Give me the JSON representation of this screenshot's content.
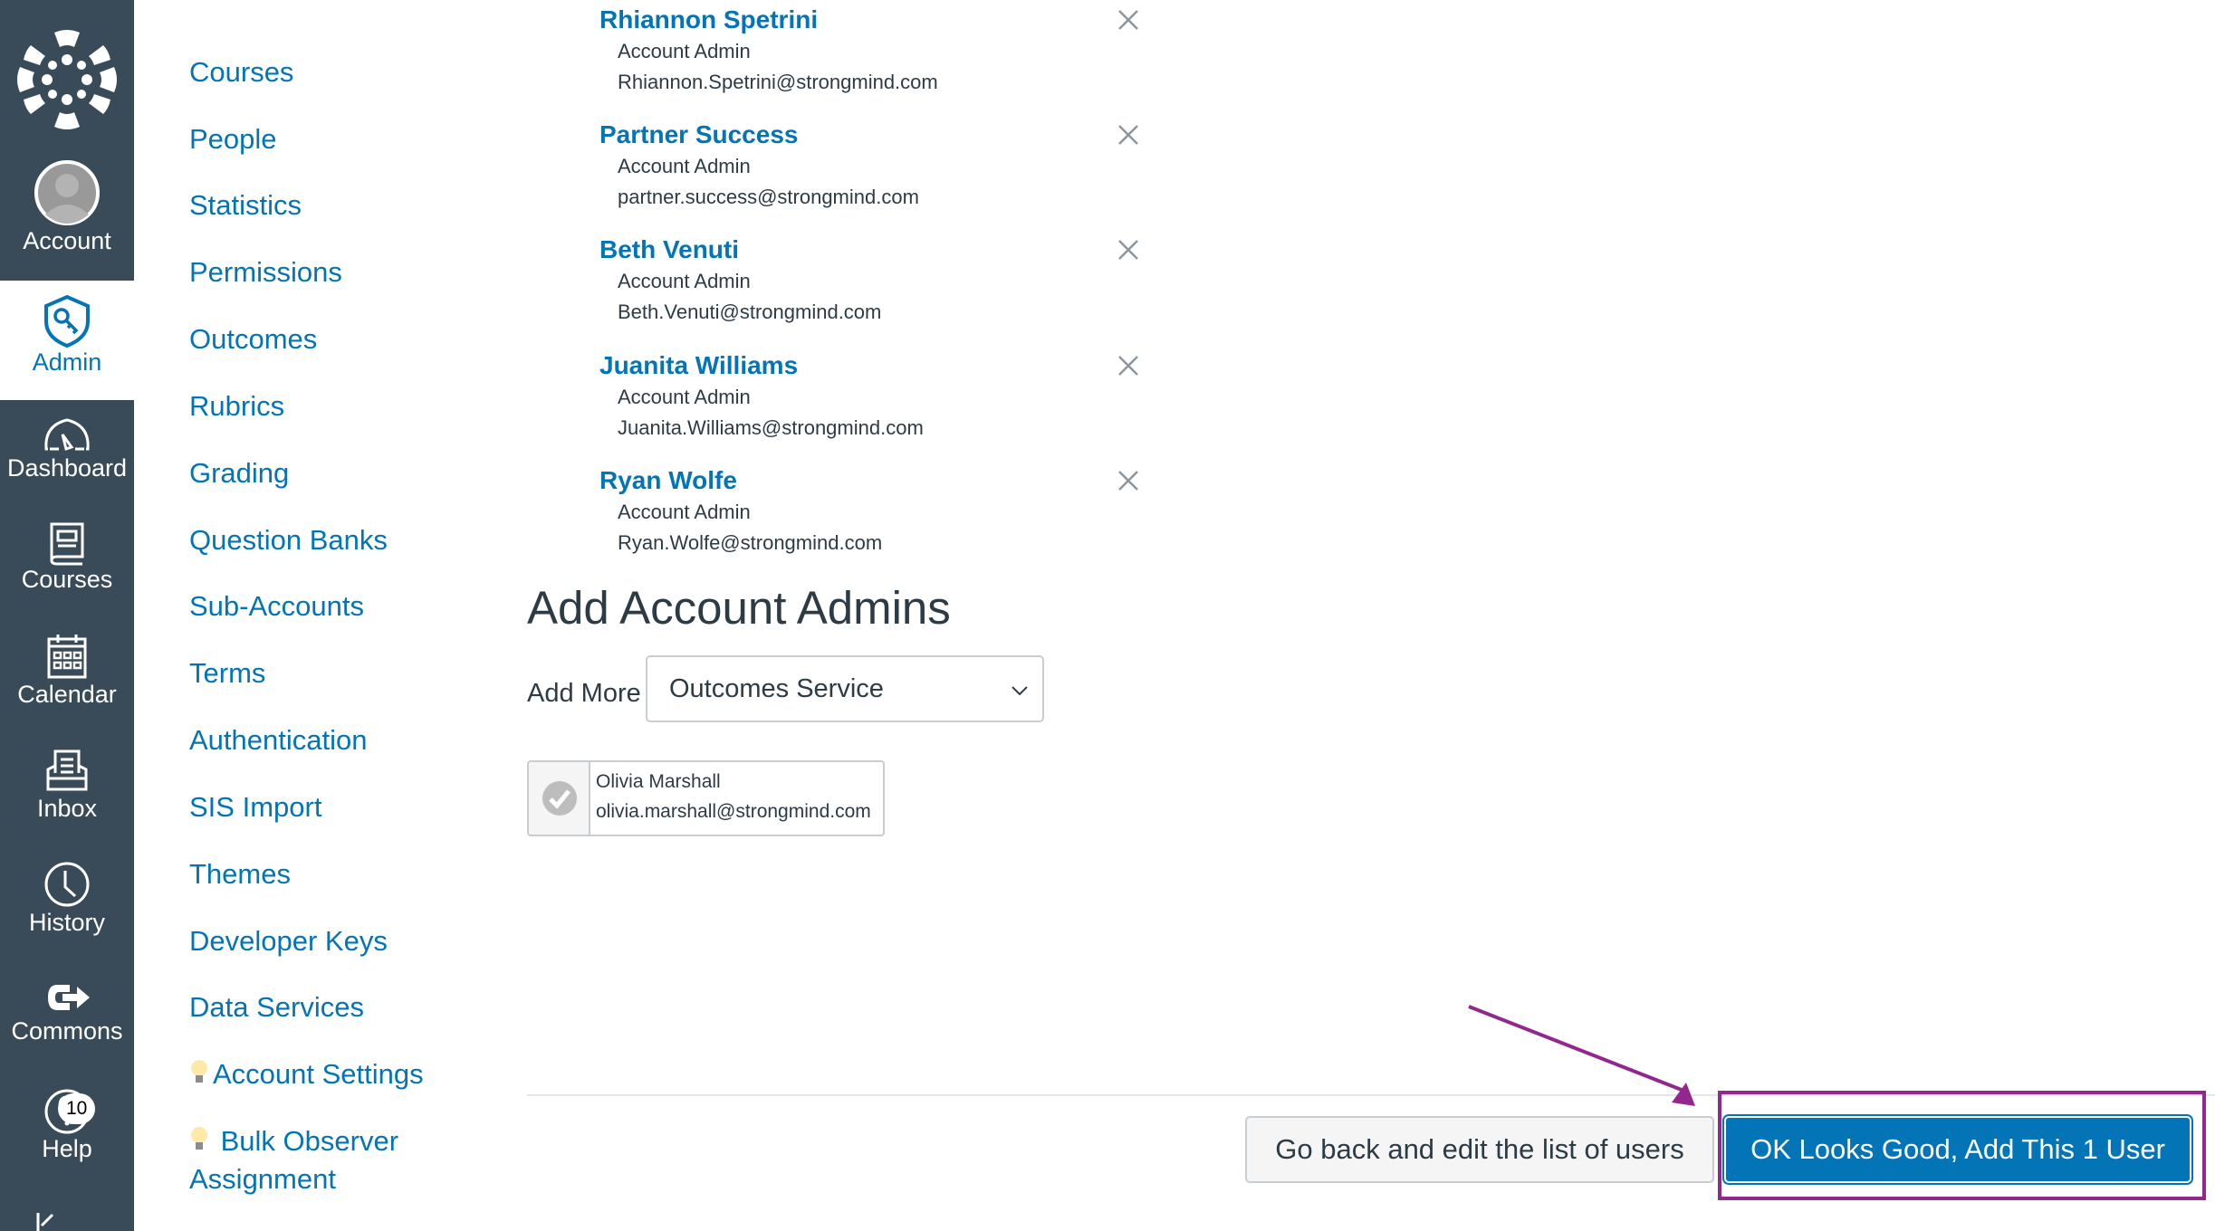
{
  "global_nav": {
    "items": [
      {
        "label": "Account",
        "icon": "avatar-icon"
      },
      {
        "label": "Admin",
        "icon": "admin-shield-key-icon",
        "active": true
      },
      {
        "label": "Dashboard",
        "icon": "dashboard-gauge-icon"
      },
      {
        "label": "Courses",
        "icon": "courses-book-icon"
      },
      {
        "label": "Calendar",
        "icon": "calendar-icon"
      },
      {
        "label": "Inbox",
        "icon": "inbox-icon"
      },
      {
        "label": "History",
        "icon": "clock-icon"
      },
      {
        "label": "Commons",
        "icon": "commons-icon"
      },
      {
        "label": "Help",
        "icon": "help-icon",
        "badge": "10"
      }
    ],
    "accent_color": "#0374b5",
    "bg_color": "#394b58"
  },
  "sub_nav": {
    "items": [
      {
        "label": "Courses"
      },
      {
        "label": "People"
      },
      {
        "label": "Statistics"
      },
      {
        "label": "Permissions"
      },
      {
        "label": "Outcomes"
      },
      {
        "label": "Rubrics"
      },
      {
        "label": "Grading"
      },
      {
        "label": "Question Banks"
      },
      {
        "label": "Sub-Accounts"
      },
      {
        "label": "Terms"
      },
      {
        "label": "Authentication"
      },
      {
        "label": "SIS Import"
      },
      {
        "label": "Themes"
      },
      {
        "label": "Developer Keys"
      },
      {
        "label": "Data Services"
      },
      {
        "label": "Account Settings",
        "icon": "lightbulb-icon"
      },
      {
        "label": "Bulk Observer",
        "label2": "Assignment",
        "icon": "lightbulb-icon"
      }
    ]
  },
  "admins": [
    {
      "name": "Rhiannon Spetrini",
      "role": "Account Admin",
      "email": "Rhiannon.Spetrini@strongmind.com"
    },
    {
      "name": "Partner Success",
      "role": "Account Admin",
      "email": "partner.success@strongmind.com"
    },
    {
      "name": "Beth Venuti",
      "role": "Account Admin",
      "email": "Beth.Venuti@strongmind.com"
    },
    {
      "name": "Juanita Williams",
      "role": "Account Admin",
      "email": "Juanita.Williams@strongmind.com"
    },
    {
      "name": "Ryan Wolfe",
      "role": "Account Admin",
      "email": "Ryan.Wolfe@strongmind.com"
    }
  ],
  "add_section": {
    "heading": "Add Account Admins",
    "add_more_label": "Add More",
    "selected_option": "Outcomes Service",
    "pending_user": {
      "name": "Olivia Marshall",
      "email": "olivia.marshall@strongmind.com"
    }
  },
  "actions": {
    "back_label": "Go back and edit the list of users",
    "ok_label": "OK Looks Good, Add This 1 User",
    "highlight_color": "#92278f"
  }
}
